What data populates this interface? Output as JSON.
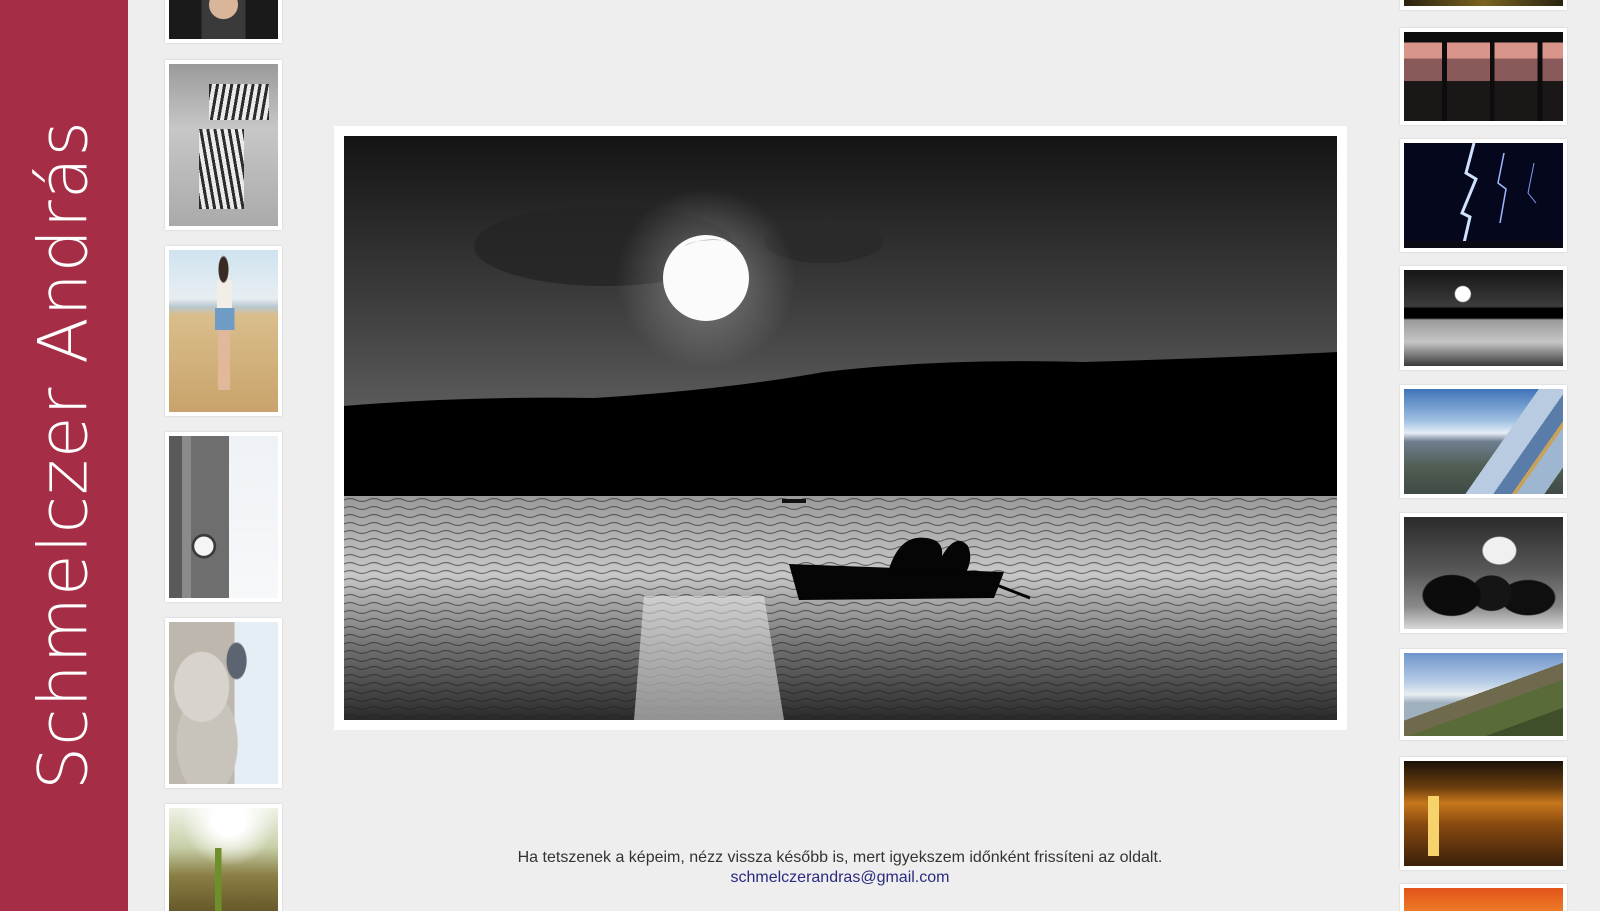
{
  "site": {
    "author_name": "Schmelczer András",
    "footer_text": "Ha tetszenek a képeim, nézz vissza később is, mert igyekszem időnként frissíteni az oldalt.",
    "contact_email": "schmelczerandras@gmail.com"
  },
  "colors": {
    "sidebar_bg": "#a52d45",
    "page_bg": "#eeeeee",
    "frame_bg": "#ffffff",
    "link": "#2a2a80"
  },
  "gallery": {
    "left_thumbs": [
      {
        "subject": "portrait-leather-jacket"
      },
      {
        "subject": "zebras-bw"
      },
      {
        "subject": "girl-on-beach"
      },
      {
        "subject": "gothic-clock-tower-bird"
      },
      {
        "subject": "statue-with-pigeon"
      },
      {
        "subject": "plant-in-sunlight"
      }
    ],
    "right_thumbs": [
      {
        "subject": "golden-top-cropped"
      },
      {
        "subject": "window-silhouette-sunset"
      },
      {
        "subject": "lightning-night"
      },
      {
        "subject": "moon-boat-lake"
      },
      {
        "subject": "binoculars-city-view"
      },
      {
        "subject": "pigeons-bw"
      },
      {
        "subject": "hillside-town"
      },
      {
        "subject": "sunset-water-ripples"
      },
      {
        "subject": "orange-sunset-cropped"
      }
    ],
    "featured": {
      "subject": "moon-boat-lake"
    }
  }
}
